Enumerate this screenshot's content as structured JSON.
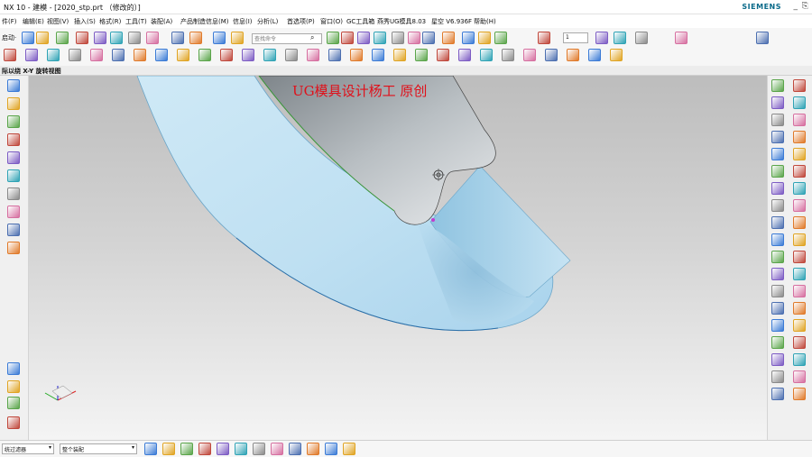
{
  "window": {
    "title": "NX 10 - 建模 - [2020_stp.prt （修改的）]",
    "brand": "SIEMENS",
    "minimize": "_",
    "restore": "⎘"
  },
  "menu": [
    "件(F)",
    "编辑(E)",
    "视图(V)",
    "插入(S)",
    "格式(R)",
    "工具(T)",
    "装配(A)",
    "产品制造信息(M)",
    "信息(I)",
    "分析(L)",
    "首选项(P)",
    "窗口(O)",
    "GC工具箱",
    "燕秀UG模具8.03",
    "星空 V6.936F",
    "帮助(H)"
  ],
  "toolbar": {
    "start_label": "启动·",
    "search_placeholder": "查找命令",
    "layer_value": "1"
  },
  "view": {
    "label": "际以绕 X-Y 旋转视图"
  },
  "viewport": {
    "watermark": "UG模具设计杨工 原创"
  },
  "statusbar": {
    "filter": "统过滤器",
    "assembly": "整个装配"
  },
  "icons": {
    "row1": [
      "new-icon",
      "open-icon",
      "save-icon",
      "cut-icon",
      "copy-icon",
      "paste-icon",
      "delete-icon",
      "undo-icon",
      "redo-icon",
      "shaded-icon",
      "sketch-icon",
      "datum-icon",
      "layer-settings-icon",
      "move-icon",
      "analysis-icon",
      "section-icon",
      "fit-icon",
      "rotate-icon",
      "render-icon",
      "color-icon",
      "assembly-icon",
      "component-icon",
      "extrude-icon",
      "revolve-icon",
      "blend-icon",
      "chamfer-icon",
      "shell-icon",
      "measure-icon",
      "ruler-icon"
    ],
    "row2": [
      "hole-icon",
      "boss-icon",
      "pad-icon",
      "slot-icon",
      "groove-icon",
      "line-icon",
      "arc-icon",
      "rectangle-icon",
      "spline-icon",
      "polygon-icon",
      "text-icon",
      "point-icon",
      "plane-icon",
      "curve-icon",
      "offset-icon",
      "trim-icon",
      "extend-icon",
      "mirror-icon",
      "pattern-icon",
      "project-icon",
      "intersect-icon",
      "bridge-icon",
      "fillet-curve-icon",
      "divide-icon",
      "join-icon",
      "surface-icon",
      "sew-icon",
      "patch-icon",
      "thicken-icon"
    ],
    "left": [
      "part-navigator-icon",
      "assembly-navigator-icon",
      "constraint-icon",
      "history-icon",
      "reuse-library-icon",
      "hd3d-icon",
      "web-browser-icon",
      "palette-icon",
      "process-studio-icon",
      "role-icon",
      "system-materials-icon",
      "system-scene-icon",
      "help-icon",
      "command-finder-icon"
    ],
    "right": [
      "sync-modeling-icon",
      "xy-icon",
      "face-icon",
      "replace-icon",
      "offset-region-icon",
      "delete-face-icon",
      "draft-icon",
      "resize-icon",
      "move-face-icon",
      "pull-face-icon",
      "pattern-face-icon",
      "mirror-face-icon",
      "copy-face-icon",
      "cut-face-icon",
      "paste-face-icon",
      "label-chamfer-icon",
      "label-blend-icon",
      "resize-blend-icon",
      "reorder-blend-icon",
      "make-coplanar-icon",
      "make-coaxial-icon",
      "make-tangent-icon",
      "make-symmetric-icon",
      "make-parallel-icon",
      "make-perpendicular-icon",
      "linear-dimension-icon",
      "angle-dimension-icon",
      "radial-dimension-icon",
      "shell-body-icon",
      "shell-face-icon",
      "snap-point-icon",
      "cross-section-icon",
      "rectangle-select-icon",
      "circle-select-icon",
      "hexagon-icon",
      "coordinate-icon",
      "grid-icon",
      "circle-icon"
    ],
    "status": [
      "select-filter-icon",
      "snap-endpoint-icon",
      "snap-midpoint-icon",
      "snap-center-icon",
      "snap-quadrant-icon",
      "snap-intersection-icon",
      "snap-perp-icon",
      "snap-tangent-icon",
      "snap-point-on-curve-icon",
      "snap-existing-point-icon",
      "snap-grid-icon",
      "snap-face-icon"
    ]
  }
}
